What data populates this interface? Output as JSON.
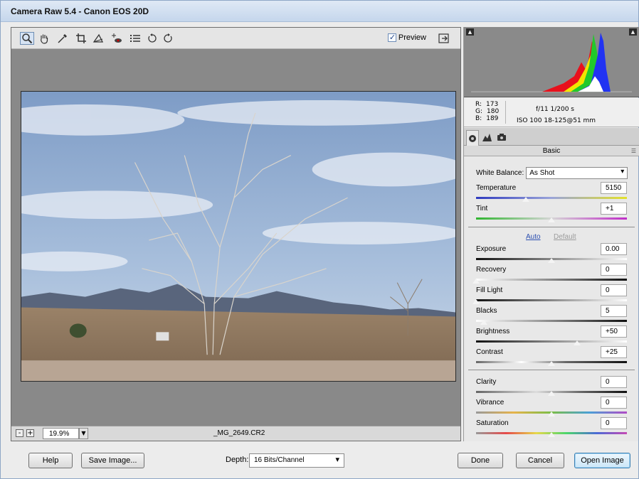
{
  "window": {
    "title": "Camera Raw 5.4  -  Canon EOS 20D"
  },
  "toolbar": {
    "tools": [
      "zoom-icon",
      "hand-icon",
      "white-balance-icon",
      "crop-icon",
      "straighten-icon",
      "red-eye-icon",
      "preferences-icon",
      "rotate-left-icon",
      "rotate-right-icon"
    ],
    "preview_label": "Preview",
    "preview_checked": true
  },
  "status": {
    "zoom_out": "-",
    "zoom_in": "+",
    "zoom_value": "19.9%",
    "filename": "_MG_2649.CR2"
  },
  "readout": {
    "r_label": "R:",
    "r_value": "173",
    "g_label": "G:",
    "g_value": "180",
    "b_label": "B:",
    "b_value": "189",
    "aperture_shutter": "f/11   1/200 s",
    "iso_lens": "ISO 100   18-125@51 mm"
  },
  "panel": {
    "title": "Basic",
    "white_balance_label": "White Balance:",
    "white_balance_value": "As Shot",
    "auto_label": "Auto",
    "default_label": "Default",
    "sliders": [
      {
        "label": "Temperature",
        "value": "5150",
        "position": 0.33
      },
      {
        "label": "Tint",
        "value": "+1",
        "position": 0.5
      },
      {
        "label": "Exposure",
        "value": "0.00",
        "position": 0.5
      },
      {
        "label": "Recovery",
        "value": "0",
        "position": 0.0
      },
      {
        "label": "Fill Light",
        "value": "0",
        "position": 0.0
      },
      {
        "label": "Blacks",
        "value": "5",
        "position": 0.05
      },
      {
        "label": "Brightness",
        "value": "+50",
        "position": 0.67
      },
      {
        "label": "Contrast",
        "value": "+25",
        "position": 0.5
      },
      {
        "label": "Clarity",
        "value": "0",
        "position": 0.5
      },
      {
        "label": "Vibrance",
        "value": "0",
        "position": 0.5
      },
      {
        "label": "Saturation",
        "value": "0",
        "position": 0.5
      }
    ]
  },
  "footer": {
    "help": "Help",
    "save_image": "Save Image...",
    "depth_label": "Depth:",
    "depth_value": "16 Bits/Channel",
    "done": "Done",
    "cancel": "Cancel",
    "open_image": "Open Image"
  },
  "colors": {
    "accent": "#3c7fb1",
    "link": "#2c4fb0",
    "viewer_bg": "#898989"
  }
}
